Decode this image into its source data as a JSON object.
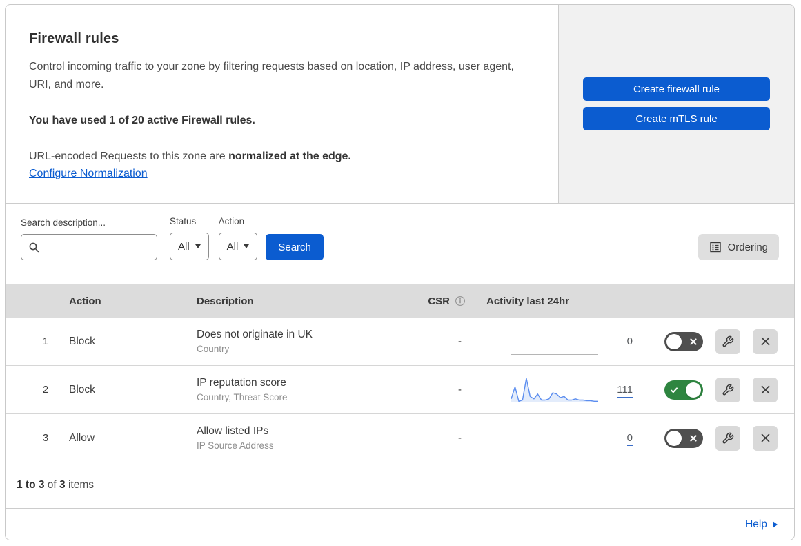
{
  "header": {
    "title": "Firewall rules",
    "description": "Control incoming traffic to your zone by filtering requests based on location, IP address, user agent, URI, and more.",
    "usage": "You have used 1 of 20 active Firewall rules.",
    "normalization_prefix": "URL-encoded Requests to this zone are ",
    "normalization_bold": "normalized at the edge.",
    "normalization_link": "Configure Normalization",
    "create_firewall_button": "Create firewall rule",
    "create_mtls_button": "Create mTLS rule"
  },
  "filters": {
    "search_label": "Search description...",
    "status_label": "Status",
    "status_value": "All",
    "action_label": "Action",
    "action_value": "All",
    "search_button": "Search",
    "ordering_button": "Ordering"
  },
  "table": {
    "columns": {
      "action": "Action",
      "description": "Description",
      "csr": "CSR",
      "activity": "Activity last 24hr"
    },
    "rows": [
      {
        "priority": "1",
        "action": "Block",
        "description": "Does not originate in UK",
        "fields": "Country",
        "csr": "-",
        "activity_value": "0",
        "enabled": false,
        "sparkline": []
      },
      {
        "priority": "2",
        "action": "Block",
        "description": "IP reputation score",
        "fields": "Country, Threat Score",
        "csr": "-",
        "activity_value": "111",
        "enabled": true,
        "sparkline": [
          3,
          13,
          1,
          2,
          20,
          5,
          3,
          7,
          2,
          2,
          3,
          8,
          7,
          4,
          5,
          2,
          2,
          3,
          2,
          2,
          1.5,
          1.5,
          1,
          1
        ]
      },
      {
        "priority": "3",
        "action": "Allow",
        "description": "Allow listed IPs",
        "fields": "IP Source Address",
        "csr": "-",
        "activity_value": "0",
        "enabled": false,
        "sparkline": []
      }
    ]
  },
  "footer": {
    "range": "1 to 3",
    "of": "of",
    "total": "3",
    "items": "items",
    "help": "Help"
  },
  "colors": {
    "accent_blue": "#0b5cd0",
    "toggle_on_green": "#2e8540",
    "toggle_off_gray": "#4f4f4f",
    "sparkline_stroke": "#5b8def",
    "sparkline_fill": "#e3ecfb",
    "flatline_gray": "#b5b5b5"
  }
}
